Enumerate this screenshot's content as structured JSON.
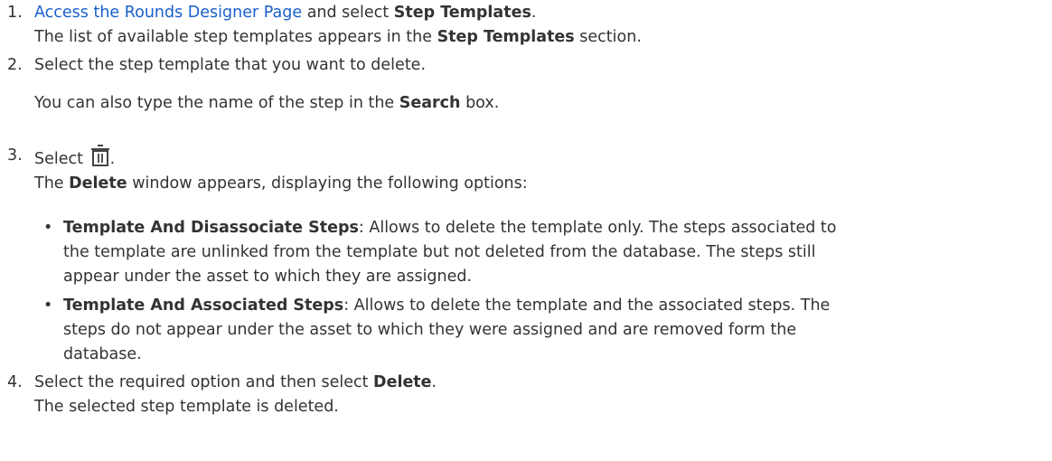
{
  "steps": [
    {
      "number": "1.",
      "pre": "",
      "link": "Access the Rounds Designer Page",
      "mid": " and select ",
      "bold": "Step Templates",
      "post": ".",
      "result_pre": "The list of available step templates appears in the ",
      "result_bold": "Step Templates",
      "result_post": " section."
    },
    {
      "number": "2.",
      "text": "Select the step template that you want to delete.",
      "note_pre": "You can also type the name of the step in the ",
      "note_bold": "Search",
      "note_post": " box."
    },
    {
      "number": "3.",
      "pre": "Select ",
      "icon": "trash-icon",
      "post": ".",
      "result_pre": "The ",
      "result_bold": "Delete",
      "result_post": " window appears, displaying the following options:",
      "options": [
        {
          "bullet": "•",
          "title": "Template And Disassociate Steps",
          "lines": [
            ": Allows to delete the template only. The steps associated to",
            "the template are unlinked from the template but not deleted from the database. The steps still",
            "appear under the asset to which they are assigned."
          ]
        },
        {
          "bullet": "•",
          "title": "Template And Associated Steps",
          "lines": [
            ": Allows to delete the template and the associated steps. The",
            "steps do not appear under the asset to which they were assigned and are removed form the",
            "database."
          ]
        }
      ]
    },
    {
      "number": "4.",
      "pre": "Select the required option and then select ",
      "bold": "Delete",
      "post": ".",
      "result": "The selected step template is deleted."
    }
  ]
}
